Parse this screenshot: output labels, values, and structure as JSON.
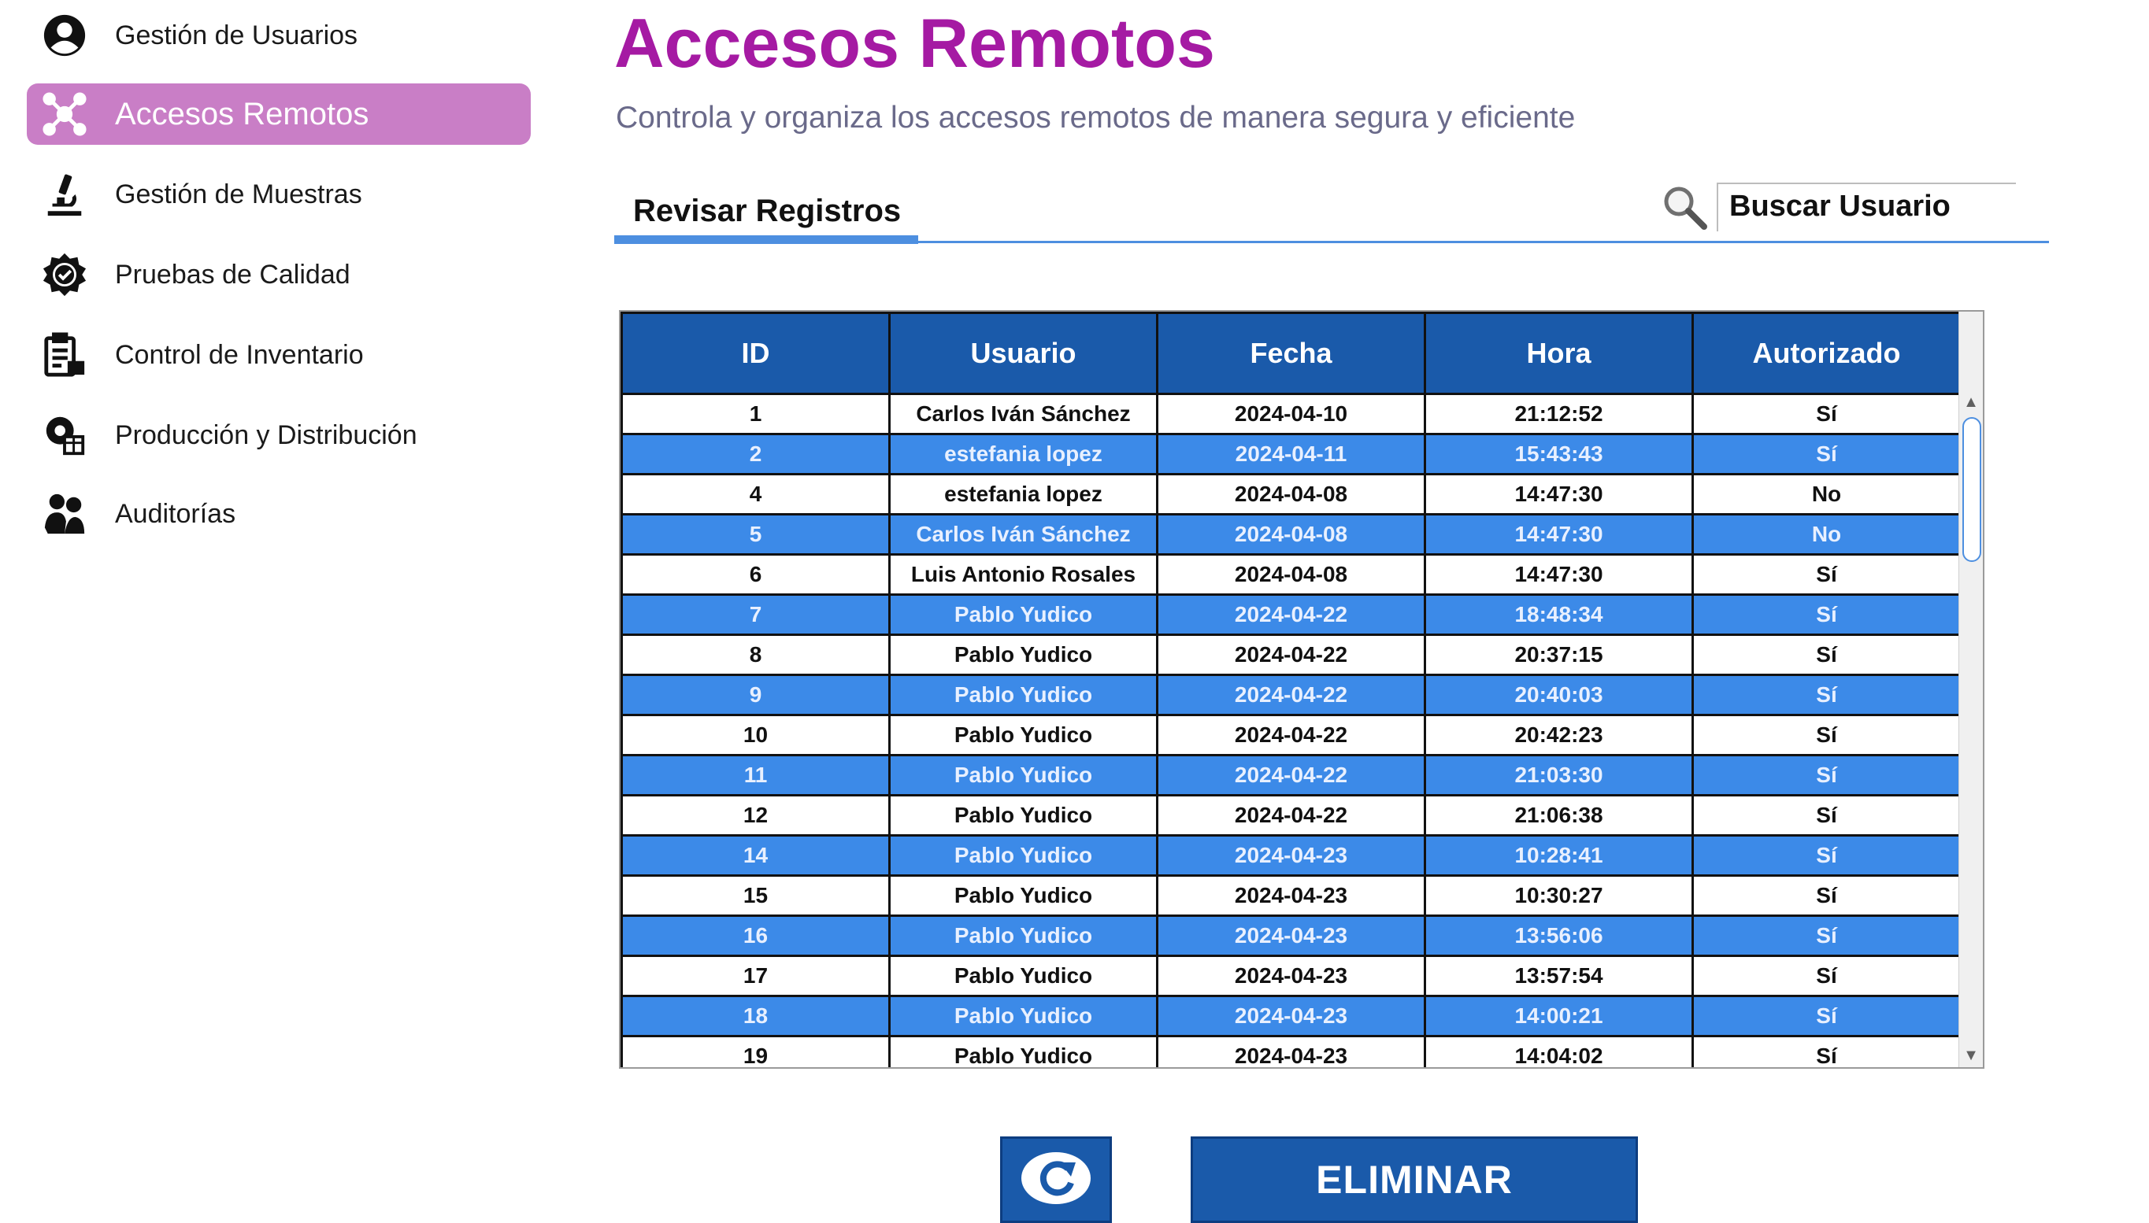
{
  "sidebar": {
    "items": [
      {
        "label": "Gestión de Usuarios",
        "icon": "user-circle-icon",
        "active": false
      },
      {
        "label": "Accesos Remotos",
        "icon": "remote-network-icon",
        "active": true
      },
      {
        "label": "Gestión de Muestras",
        "icon": "microscope-icon",
        "active": false
      },
      {
        "label": "Pruebas de Calidad",
        "icon": "quality-badge-icon",
        "active": false
      },
      {
        "label": "Control de Inventario",
        "icon": "clipboard-icon",
        "active": false
      },
      {
        "label": "Producción y Distribución",
        "icon": "gear-box-icon",
        "active": false
      },
      {
        "label": "Auditorías",
        "icon": "people-icon",
        "active": false
      }
    ]
  },
  "header": {
    "title": "Accesos Remotos",
    "subtitle": "Controla y organiza los accesos remotos de manera segura y eficiente"
  },
  "tab": {
    "label": "Revisar Registros"
  },
  "search": {
    "value": "Buscar Usuario",
    "icon": "search-icon"
  },
  "table": {
    "columns": [
      "ID",
      "Usuario",
      "Fecha",
      "Hora",
      "Autorizado"
    ],
    "rows": [
      [
        "1",
        "Carlos Iván Sánchez",
        "2024-04-10",
        "21:12:52",
        "Sí"
      ],
      [
        "2",
        "estefania lopez",
        "2024-04-11",
        "15:43:43",
        "Sí"
      ],
      [
        "4",
        "estefania lopez",
        "2024-04-08",
        "14:47:30",
        "No"
      ],
      [
        "5",
        "Carlos Iván Sánchez",
        "2024-04-08",
        "14:47:30",
        "No"
      ],
      [
        "6",
        "Luis Antonio Rosales",
        "2024-04-08",
        "14:47:30",
        "Sí"
      ],
      [
        "7",
        "Pablo Yudico",
        "2024-04-22",
        "18:48:34",
        "Sí"
      ],
      [
        "8",
        "Pablo Yudico",
        "2024-04-22",
        "20:37:15",
        "Sí"
      ],
      [
        "9",
        "Pablo Yudico",
        "2024-04-22",
        "20:40:03",
        "Sí"
      ],
      [
        "10",
        "Pablo Yudico",
        "2024-04-22",
        "20:42:23",
        "Sí"
      ],
      [
        "11",
        "Pablo Yudico",
        "2024-04-22",
        "21:03:30",
        "Sí"
      ],
      [
        "12",
        "Pablo Yudico",
        "2024-04-22",
        "21:06:38",
        "Sí"
      ],
      [
        "14",
        "Pablo Yudico",
        "2024-04-23",
        "10:28:41",
        "Sí"
      ],
      [
        "15",
        "Pablo Yudico",
        "2024-04-23",
        "10:30:27",
        "Sí"
      ],
      [
        "16",
        "Pablo Yudico",
        "2024-04-23",
        "13:56:06",
        "Sí"
      ],
      [
        "17",
        "Pablo Yudico",
        "2024-04-23",
        "13:57:54",
        "Sí"
      ],
      [
        "18",
        "Pablo Yudico",
        "2024-04-23",
        "14:00:21",
        "Sí"
      ],
      [
        "19",
        "Pablo Yudico",
        "2024-04-23",
        "14:04:02",
        "Sí"
      ]
    ]
  },
  "buttons": {
    "refresh_icon": "refresh-icon",
    "delete_label": "ELIMINAR"
  },
  "colors": {
    "title": "#a51aa3",
    "active_nav": "#c97ec6",
    "table_header": "#1a5aaa",
    "row_alt": "#3c8ae8",
    "accent_line": "#4d8fe0",
    "button": "#1a5aaa"
  }
}
